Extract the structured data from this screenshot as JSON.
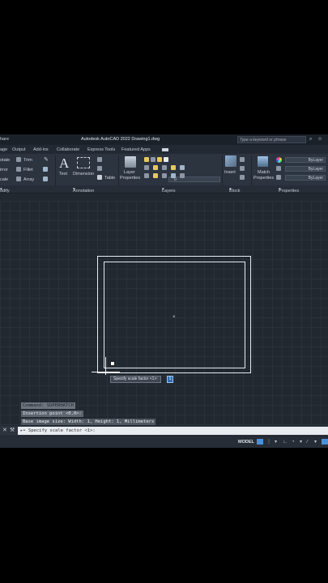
{
  "titlebar": {
    "share": "hare",
    "title": "Autodesk AutoCAD 2022   Drawing1.dwg",
    "search_placeholder": "Type a keyword or phrase"
  },
  "tabs": [
    "age",
    "Output",
    "Add-ins",
    "Collaborate",
    "Express Tools",
    "Featured Apps"
  ],
  "ribbon": {
    "modify": {
      "items": [
        "otate",
        "Trim",
        "irror",
        "Fillet",
        "cale",
        "Array"
      ],
      "footer": "odify"
    },
    "annotation": {
      "text_label": "Text",
      "dimension_label": "Dimension",
      "table_label": "Table",
      "footer": "Annotation"
    },
    "layers": {
      "layer_properties_line1": "Layer",
      "layer_properties_line2": "Properties",
      "layer_dropdown": "0",
      "footer": "Layers"
    },
    "block": {
      "insert_label": "Insert",
      "footer": "Block"
    },
    "properties": {
      "match_line1": "Match",
      "match_line2": "Properties",
      "bylayer_values": [
        "ByLayer",
        "ByLayer",
        "ByLayer"
      ],
      "footer": "Properties"
    }
  },
  "tooltip": {
    "text": "Specify scale factor <1>:",
    "value": "1"
  },
  "command": {
    "history": [
      "Command: SUPERHATCH",
      "Insertion point <0,0>:",
      "Base image size: Width: 1, Height: 1, Millimeters"
    ],
    "prompt": "▸• Specify scale factor <1>:"
  },
  "statusbar": {
    "model": "MODEL"
  },
  "colors": {
    "background": "#212830",
    "ribbon": "#2c3440",
    "accent": "#4a90d9"
  }
}
